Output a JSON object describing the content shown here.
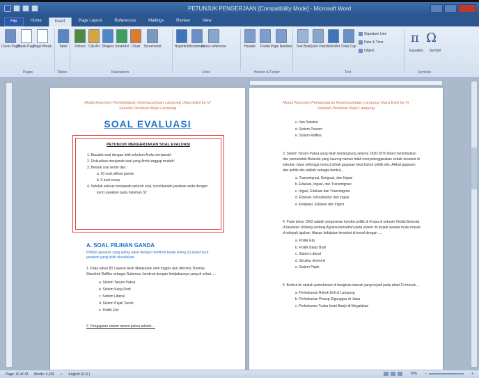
{
  "window": {
    "title": "PETUNJUK PENGERJAAN [Compatibility Mode] - Microsoft Word"
  },
  "tabs": [
    "File",
    "Home",
    "Insert",
    "Page Layout",
    "References",
    "Mailings",
    "Review",
    "View"
  ],
  "ribbon": {
    "buttons": [
      {
        "label": "Cover Page",
        "icon": "cover-page-icon",
        "color": "#6d8fc4"
      },
      {
        "label": "Blank Page",
        "icon": "blank-page-icon",
        "color": "#ffffff"
      },
      {
        "label": "Page Break",
        "icon": "page-break-icon",
        "color": "#ffffff"
      },
      {
        "label": "Table",
        "icon": "table-icon",
        "color": "#5d86c0"
      },
      {
        "label": "Picture",
        "icon": "picture-icon",
        "color": "#4b8b3b"
      },
      {
        "label": "Clip Art",
        "icon": "clip-art-icon",
        "color": "#d9a43a"
      },
      {
        "label": "Shapes",
        "icon": "shapes-icon",
        "color": "#4f87c9"
      },
      {
        "label": "SmartArt",
        "icon": "smartart-icon",
        "color": "#3aa05a"
      },
      {
        "label": "Chart",
        "icon": "chart-icon",
        "color": "#e07b29"
      },
      {
        "label": "Screenshot",
        "icon": "screenshot-icon",
        "color": "#7d98bd"
      },
      {
        "label": "Hyperlink",
        "icon": "hyperlink-icon",
        "color": "#3e74b8"
      },
      {
        "label": "Bookmark",
        "icon": "bookmark-icon",
        "color": "#6a8fc6"
      },
      {
        "label": "Cross-reference",
        "icon": "cross-reference-icon",
        "color": "#8aa6cf"
      },
      {
        "label": "Header",
        "icon": "header-icon",
        "color": "#7e9ccc"
      },
      {
        "label": "Footer",
        "icon": "footer-icon",
        "color": "#7e9ccc"
      },
      {
        "label": "Page Number",
        "icon": "page-number-icon",
        "color": "#7e9ccc"
      },
      {
        "label": "Text Box",
        "icon": "text-box-icon",
        "color": "#9ab3d8"
      },
      {
        "label": "Quick Parts",
        "icon": "quick-parts-icon",
        "color": "#8aa6cf"
      },
      {
        "label": "WordArt",
        "icon": "wordart-icon",
        "color": "#3e74b8"
      },
      {
        "label": "Drop Cap",
        "icon": "drop-cap-icon",
        "color": "#6a8fc6"
      }
    ],
    "side_buttons": [
      "Signature Line",
      "Date & Time",
      "Object"
    ],
    "equation_label": "Equation",
    "symbol_label": "Symbol",
    "groups": [
      "Pages",
      "Tables",
      "Illustrations",
      "Links",
      "Header & Footer",
      "Text",
      "Symbols"
    ]
  },
  "page1": {
    "header": [
      "Modul Asesmen Pembelajaran Kewirausahaan Lampung Utara Edisi ke-VI",
      "Sekolah Penilaian Balai Lampung"
    ],
    "title": "SOAL EVALUASI",
    "box_title": "PETUNJUK MENGERJAKAN SOAL EVALUASI",
    "box_items": [
      {
        "text": "1. Bacalah soal dengan teliti sebelum Anda menjawab!",
        "sub": false
      },
      {
        "text": "2. Diskusikan menjawab soal yang Anda anggap mudah!",
        "sub": false
      },
      {
        "text": "3. Bentuk soal terdiri dari :",
        "sub": false
      },
      {
        "text": "a. 20 soal pilihan ganda",
        "sub": true
      },
      {
        "text": "b. 5 soal essay",
        "sub": true
      },
      {
        "text": "4. Setelah selesai menjawab seluruh soal, cocokkanlah jawaban anda dengan",
        "sub": false
      },
      {
        "text": "kunci jawaban pada halaman 32",
        "sub": true
      }
    ],
    "section_title": "A. SOAL PILIHAN GANDA",
    "section_sub": "Pilihlah jawaban yang paling tepat dengan memberi tanda silang (x) pada huruf jawaban yang telah disediakan.",
    "question": "1. Pada tahun 80 Lawson telah Melakukan oleh Inggris dan diterima Thomas Stamford Raffles sebagai Gubernur Jenderal dengan kebijakannya yang di sebut ....",
    "options": [
      "a. Sistem Tanam Paksa",
      "b. Sistem Kerja Rodi",
      "c. Sistem Liberal",
      "d. Sistem Pajak Tanah",
      "e. Politik Etis"
    ],
    "footer_question": "2. Pengajaran sistem tanam paksa adalah...."
  },
  "page2": {
    "header": [
      "Modul Asesmen Pembelajaran Kewirausahaan Lampung Utara Edisi ke-VI",
      "Sekolah Penilaian Balai Lampung"
    ],
    "q_opts": [
      "c. Van Swieten",
      "d. Sistem Purwen",
      "e. Sistem Raffles"
    ],
    "q3": "3. Sistem Tanam Paksa yang telah berlangsung selama 1830-1870 telah menimbulkan dan pemerintah Belanda yang kaunng namun tidak menyelenggarakan sebab tersebut di sebutan Jawa sehingga muncul pihak gagasan lokal kulturl politik etis. Akibat gagasan dari politik etis adalah sebagai berikut....",
    "q3_opts": [
      "a. Transmigrasi, Emigrasi, dan Irigasi",
      "b. Edukasi, Irigasi, dan Transmigrasi",
      "c. Irigasi, Edukasi dan Transmigrasi",
      "d. Edukasi, Infrastruktur dan Irigasi",
      "e. Emigrasi, Edukasi dan Irigasi"
    ],
    "q4": "4. Pada tahun 1902 adalah pergeseran kondisi politik di Eropa di sebuah Hindia Belanda di keuletan Undang-undang Agraria kemudian pada sistem ini terjadi swasta mulai masuk di wilayah jajahan. Alasan kebijakan tersebut di kenal dengan ....",
    "q4_opts": [
      "a. Politik Etis",
      "b. Politik Balas Budi",
      "c. Sistem Liberal",
      "d. Struktur ekonomi",
      "e. Sistem Pajak"
    ],
    "q5": "5. Berikut ini adalah perkebunan di bengkulu daerah yang terjadi pada abad 19 masuk....",
    "q5_opts": [
      "a. Perkebunan Rokok Deli di Lampung",
      "b. Perkebunan Pinang Digunggus di Jawa",
      "c. Perkebunan Tuaka Ireari Banjir di Megalakan"
    ]
  },
  "status": {
    "page": "Page: 30 of 33",
    "words": "Words: 4,336",
    "language": "English (U.S.)",
    "zoom": "70%"
  }
}
